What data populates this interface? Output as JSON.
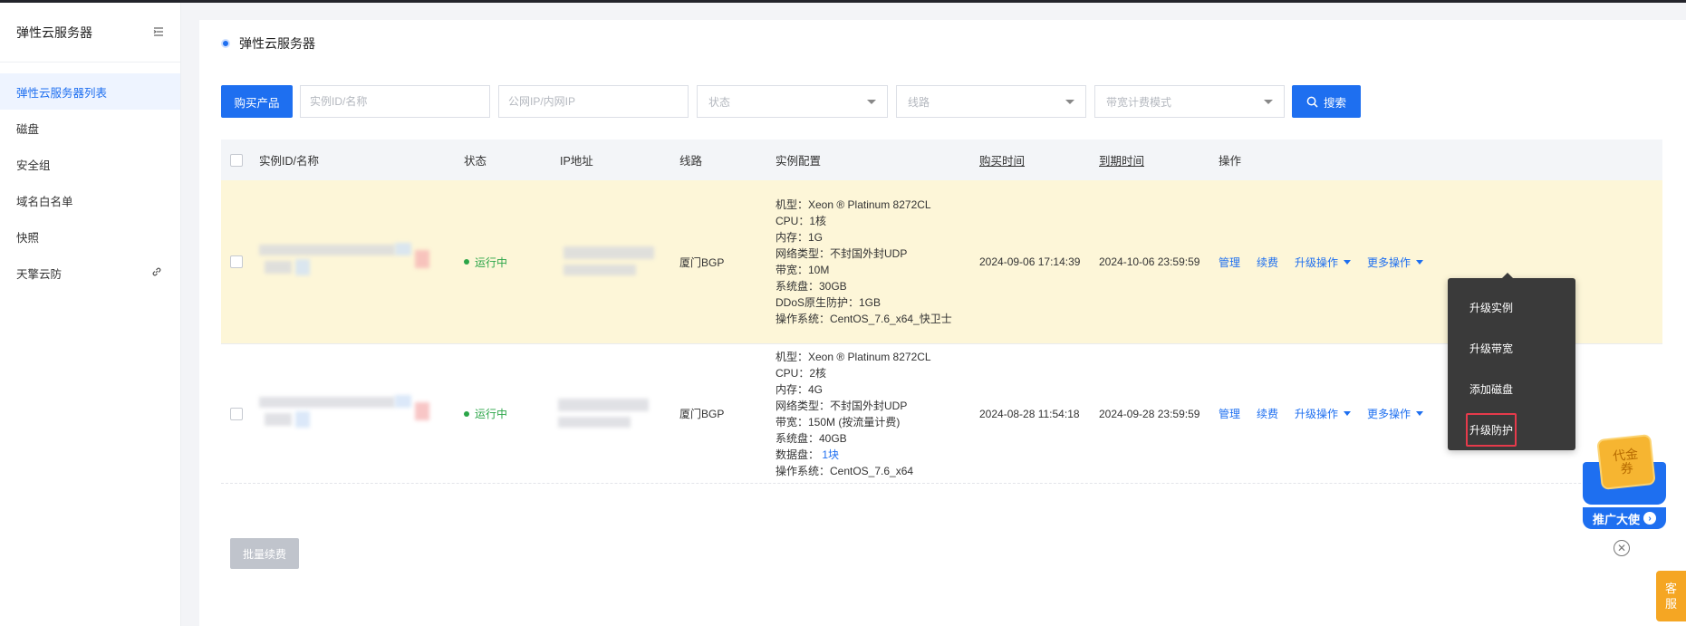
{
  "sidebar": {
    "title": "弹性云服务器",
    "items": [
      {
        "label": "弹性云服务器列表",
        "active": true
      },
      {
        "label": "磁盘"
      },
      {
        "label": "安全组"
      },
      {
        "label": "域名白名单"
      },
      {
        "label": "快照"
      },
      {
        "label": "天擎云防",
        "external": true
      }
    ]
  },
  "page": {
    "title": "弹性云服务器"
  },
  "toolbar": {
    "buy_label": "购买产品",
    "instance_placeholder": "实例ID/名称",
    "ip_placeholder": "公网IP/内网IP",
    "status_placeholder": "状态",
    "line_placeholder": "线路",
    "billing_placeholder": "带宽计费模式",
    "search_label": "搜索"
  },
  "table": {
    "headers": {
      "id": "实例ID/名称",
      "status": "状态",
      "ip": "IP地址",
      "line": "线路",
      "config": "实例配置",
      "buy_time": "购买时间",
      "expire_time": "到期时间",
      "ops": "操作"
    },
    "rows": [
      {
        "status": "运行中",
        "line": "厦门BGP",
        "config": {
          "model": "机型：Xeon ® Platinum 8272CL",
          "cpu": "CPU：1核",
          "memory": "内存：1G",
          "network": "网络类型：不封国外封UDP",
          "bandwidth": "带宽：10M",
          "system_disk": "系统盘：30GB",
          "ddos": "DDoS原生防护：1GB",
          "os": "操作系统：CentOS_7.6_x64_快卫士"
        },
        "buy_time": "2024-09-06 17:14:39",
        "expire_time": "2024-10-06 23:59:59"
      },
      {
        "status": "运行中",
        "line": "厦门BGP",
        "config": {
          "model": "机型：Xeon ® Platinum 8272CL",
          "cpu": "CPU：2核",
          "memory": "内存：4G",
          "network": "网络类型：不封国外封UDP",
          "bandwidth": "带宽：150M (按流量计费)",
          "system_disk": "系统盘：40GB",
          "data_disk_label": "数据盘：",
          "data_disk_link": "1块",
          "os": "操作系统：CentOS_7.6_x64"
        },
        "buy_time": "2024-08-28 11:54:18",
        "expire_time": "2024-09-28 23:59:59"
      }
    ],
    "ops": {
      "manage": "管理",
      "renew": "续费",
      "upgrade": "升级操作",
      "more": "更多操作"
    }
  },
  "batch_renew_label": "批量续费",
  "dropdown": {
    "items": [
      "升级实例",
      "升级带宽",
      "添加磁盘",
      "升级防护"
    ]
  },
  "promo": {
    "coupon_text": "代金券",
    "label": "推广大使",
    "arrow": "›"
  },
  "service_label": "客服",
  "colors": {
    "primary": "#1e6ff0",
    "running": "#2ba548",
    "highlight_row": "#fdf6d8",
    "dropdown_bg": "#3a3a3a",
    "focus_box": "#e63a4b"
  }
}
